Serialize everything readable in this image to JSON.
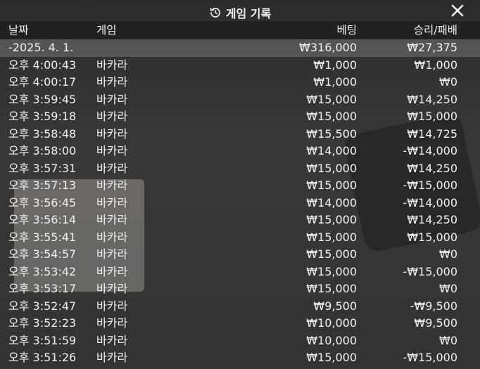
{
  "header": {
    "title": "게임 기록",
    "icon": "history-icon",
    "close_icon": "close-icon"
  },
  "columns": {
    "date": "날짜",
    "game": "게임",
    "bet": "베팅",
    "result": "승리/패배"
  },
  "summary": {
    "date": "-2025. 4. 1.",
    "bet": "₩316,000",
    "result": "₩27,375"
  },
  "rows": [
    {
      "time": "오후 4:00:43",
      "game": "바카라",
      "bet": "₩1,000",
      "result": "₩1,000"
    },
    {
      "time": "오후 4:00:17",
      "game": "바카라",
      "bet": "₩1,000",
      "result": "₩0"
    },
    {
      "time": "오후 3:59:45",
      "game": "바카라",
      "bet": "₩15,000",
      "result": "₩14,250"
    },
    {
      "time": "오후 3:59:18",
      "game": "바카라",
      "bet": "₩15,000",
      "result": "₩15,000"
    },
    {
      "time": "오후 3:58:48",
      "game": "바카라",
      "bet": "₩15,500",
      "result": "₩14,725"
    },
    {
      "time": "오후 3:58:00",
      "game": "바카라",
      "bet": "₩14,000",
      "result": "-₩14,000"
    },
    {
      "time": "오후 3:57:31",
      "game": "바카라",
      "bet": "₩15,000",
      "result": "₩14,250"
    },
    {
      "time": "오후 3:57:13",
      "game": "바카라",
      "bet": "₩15,000",
      "result": "-₩15,000"
    },
    {
      "time": "오후 3:56:45",
      "game": "바카라",
      "bet": "₩14,000",
      "result": "-₩14,000"
    },
    {
      "time": "오후 3:56:14",
      "game": "바카라",
      "bet": "₩15,000",
      "result": "₩14,250"
    },
    {
      "time": "오후 3:55:41",
      "game": "바카라",
      "bet": "₩15,000",
      "result": "₩15,000"
    },
    {
      "time": "오후 3:54:57",
      "game": "바카라",
      "bet": "₩15,000",
      "result": "₩0"
    },
    {
      "time": "오후 3:53:42",
      "game": "바카라",
      "bet": "₩15,000",
      "result": "-₩15,000"
    },
    {
      "time": "오후 3:53:17",
      "game": "바카라",
      "bet": "₩15,000",
      "result": "₩0"
    },
    {
      "time": "오후 3:52:47",
      "game": "바카라",
      "bet": "₩9,500",
      "result": "-₩9,500"
    },
    {
      "time": "오후 3:52:23",
      "game": "바카라",
      "bet": "₩10,000",
      "result": "₩9,500"
    },
    {
      "time": "오후 3:51:59",
      "game": "바카라",
      "bet": "₩10,000",
      "result": "₩0"
    },
    {
      "time": "오후 3:51:26",
      "game": "바카라",
      "bet": "₩15,000",
      "result": "-₩15,000"
    }
  ],
  "colors": {
    "text": "#f2f2f2",
    "header_bg": "#1e1d1c",
    "date_row_bg": "#dcdcdc"
  }
}
